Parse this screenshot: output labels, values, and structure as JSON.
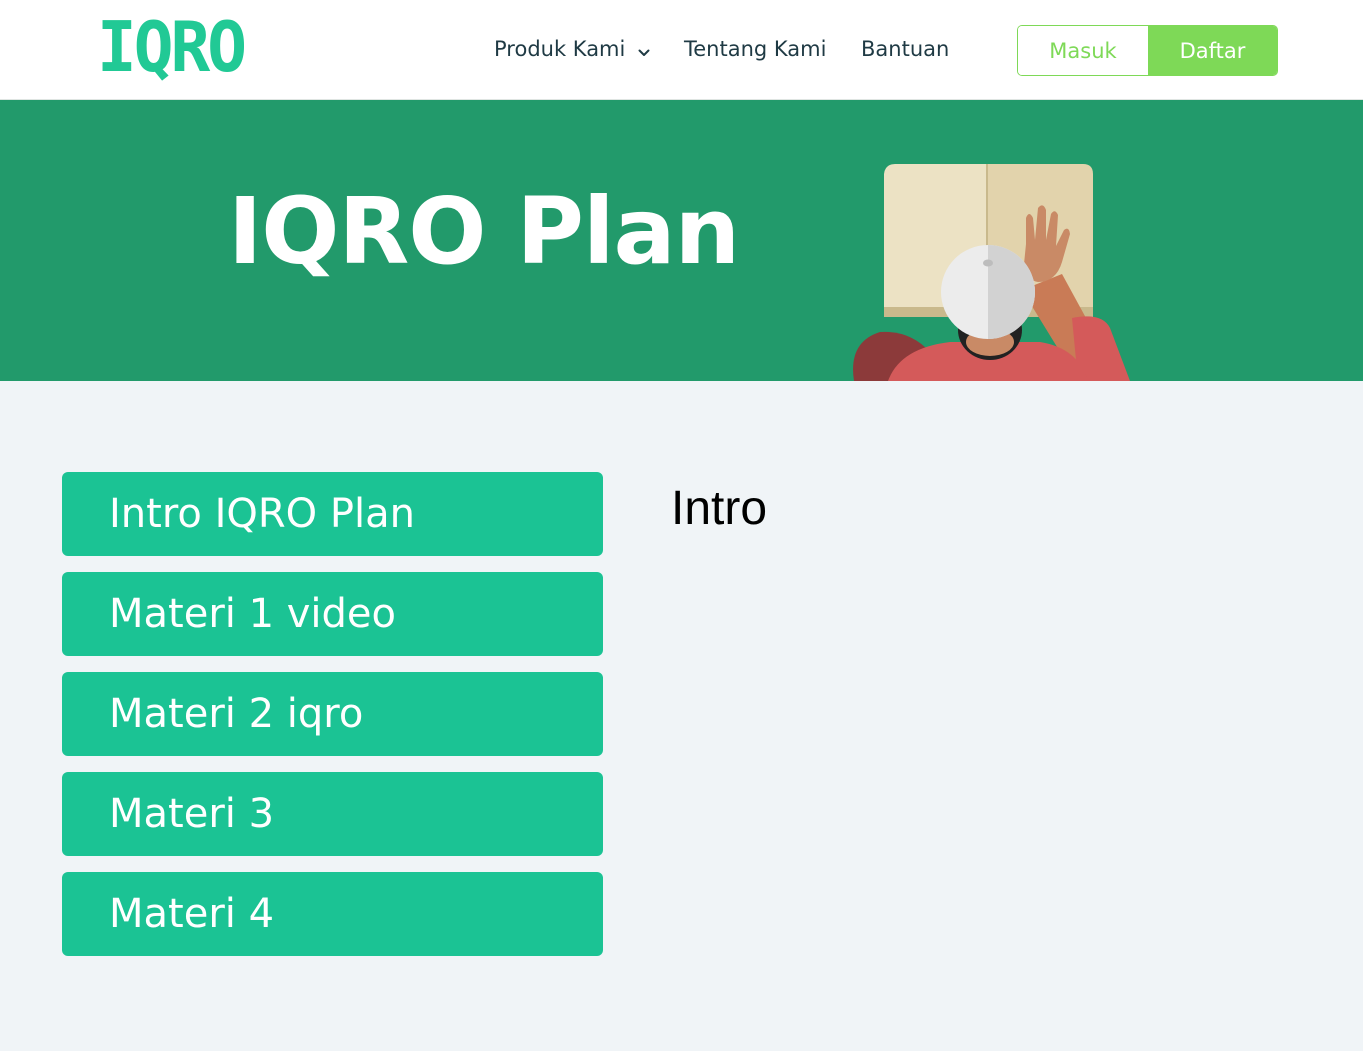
{
  "header": {
    "logo_text": "IQRO",
    "nav": [
      {
        "label": "Produk Kami"
      },
      {
        "label": "Tentang Kami"
      },
      {
        "label": "Bantuan"
      }
    ],
    "login_label": "Masuk",
    "register_label": "Daftar"
  },
  "hero": {
    "title": "IQRO Plan"
  },
  "sidebar": {
    "items": [
      {
        "label": "Intro IQRO Plan"
      },
      {
        "label": "Materi 1 video"
      },
      {
        "label": "Materi 2 iqro"
      },
      {
        "label": "Materi 3"
      },
      {
        "label": "Materi 4"
      }
    ]
  },
  "content": {
    "title": "Intro"
  },
  "colors": {
    "brand": "#21c995",
    "hero_bg": "#229a6b",
    "sidebar_item_bg": "#1bc394",
    "accent_green": "#7ed957",
    "page_bg": "#f0f4f7"
  },
  "icons": {
    "dropdown": "chevron-down-icon",
    "hero_image": "reading-person-illustration"
  }
}
